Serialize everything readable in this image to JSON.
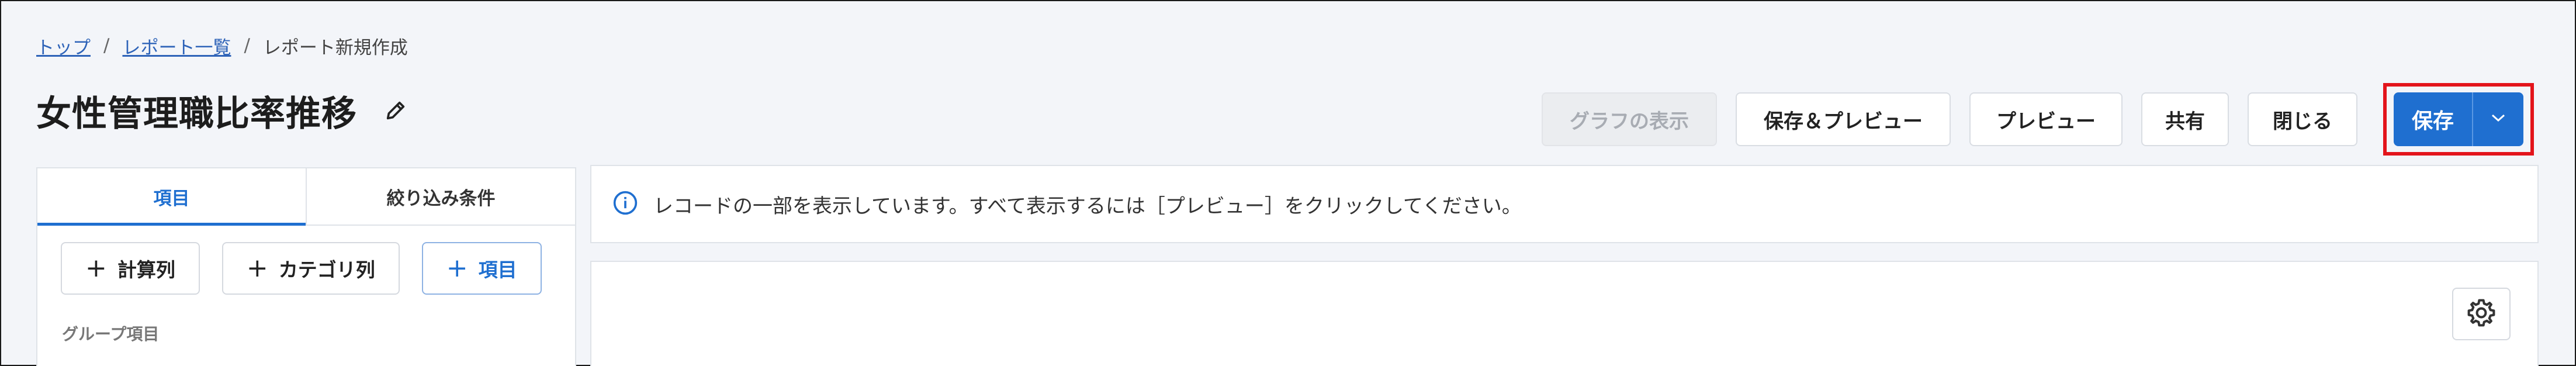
{
  "breadcrumb": {
    "items": [
      {
        "label": "トップ",
        "link": true
      },
      {
        "label": "レポート一覧",
        "link": true
      },
      {
        "label": "レポート新規作成",
        "link": false
      }
    ],
    "separator": "/"
  },
  "header": {
    "title": "女性管理職比率推移",
    "edit_icon": "pencil-icon"
  },
  "toolbar": {
    "show_graph_label": "グラフの表示",
    "save_preview_label": "保存＆プレビュー",
    "preview_label": "プレビュー",
    "share_label": "共有",
    "close_label": "閉じる",
    "save_label": "保存",
    "save_menu_icon": "chevron-down-icon"
  },
  "left_panel": {
    "tabs": [
      {
        "label": "項目",
        "active": true
      },
      {
        "label": "絞り込み条件",
        "active": false
      }
    ],
    "add_buttons": {
      "calc_column": "計算列",
      "category_column": "カテゴリ列",
      "item": "項目"
    },
    "group_label": "グループ項目"
  },
  "info": {
    "icon": "info-icon",
    "message": "レコードの一部を表示しています。すべて表示するには［プレビュー］をクリックしてください。"
  },
  "content": {
    "settings_icon": "gear-icon"
  },
  "colors": {
    "accent": "#1f6fd0",
    "highlight_border": "#e3141b",
    "background": "#f3f5f9"
  }
}
